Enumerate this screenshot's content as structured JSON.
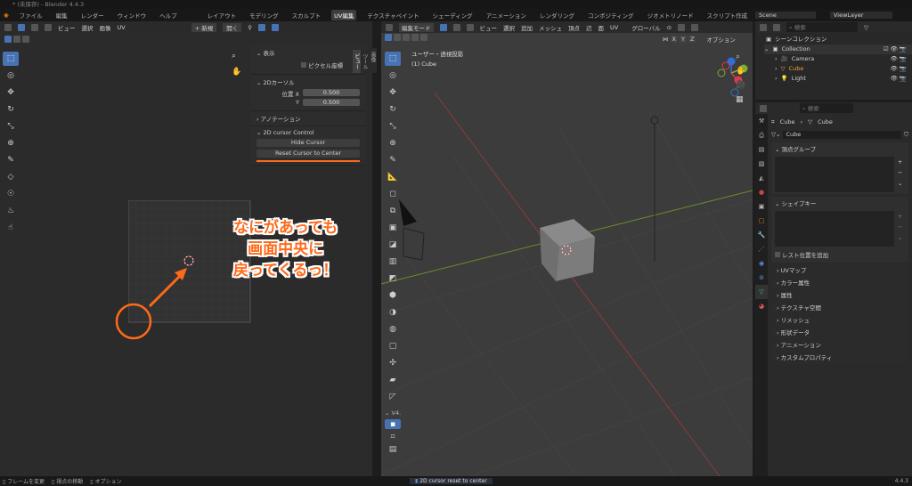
{
  "title": "* (未保存) - Blender 4.4.3",
  "menu": [
    "ファイル",
    "編集",
    "レンダー",
    "ウィンドウ",
    "ヘルプ"
  ],
  "workspaces": [
    "レイアウト",
    "モデリング",
    "スカルプト",
    "UV編集",
    "テクスチャペイント",
    "シェーディング",
    "アニメーション",
    "レンダリング",
    "コンポジティング",
    "ジオメトリノード",
    "スクリプト作成"
  ],
  "scene": "Scene",
  "view_layer": "ViewLayer",
  "uv_header": {
    "menus": [
      "ビュー",
      "選択",
      "画像",
      "UV"
    ],
    "new": "+ 新規",
    "open": "開く"
  },
  "npanel": {
    "display": "表示",
    "pixel_coords": "ピクセル座標",
    "cursor2d": "2Dカーソル",
    "pos_x_label": "位置 X",
    "pos_y_label": "Y",
    "pos_x": "0.500",
    "pos_y": "0.500",
    "annotation": "アノテーション",
    "control": "2D cursor Control",
    "hide": "Hide Cursor",
    "reset": "Reset Cursor to Center",
    "tabs": [
      "画像",
      "ツール",
      "ビュー"
    ]
  },
  "annotation_text": [
    "なにがあっても",
    "画面中央に",
    "戻ってくるっ！"
  ],
  "v3d_header": {
    "mode": "編集モード",
    "menus": [
      "ビュー",
      "選択",
      "追加",
      "メッシュ",
      "頂点",
      "辺",
      "面",
      "UV"
    ],
    "orientation": "グローバル",
    "options": "オプション",
    "axes": [
      "X",
      "Y",
      "Z"
    ]
  },
  "viewport": {
    "view_name": "ユーザー・透視投影",
    "object": "(1) Cube",
    "v4_label": "V4."
  },
  "outliner": {
    "search": "検索",
    "scene_collection": "シーンコレクション",
    "collection": "Collection",
    "items": [
      "Camera",
      "Cube",
      "Light"
    ]
  },
  "properties": {
    "search": "検索",
    "breadcrumb": [
      "Cube",
      "Cube"
    ],
    "mesh_name": "Cube",
    "vgroups": "頂点グループ",
    "shapekeys": "シェイプキー",
    "rest_pos": "レスト位置を追加",
    "sections": [
      "UVマップ",
      "カラー属性",
      "属性",
      "テクスチャ空間",
      "リメッシュ",
      "形状データ",
      "アニメーション",
      "カスタムプロパティ"
    ]
  },
  "status": {
    "left": [
      "フレームを変更",
      "視点の移動",
      "オプション"
    ],
    "report": "2D cursor reset to center",
    "version": "4.4.3"
  },
  "colors": {
    "accent": "#4772b3",
    "orange": "#ff6a1a",
    "active_tab": "#e87d0d"
  }
}
